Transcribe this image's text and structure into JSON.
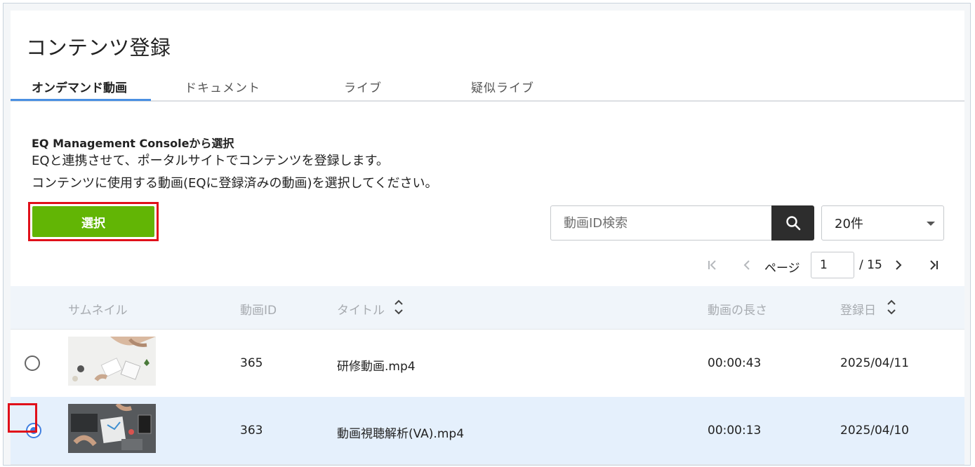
{
  "page": {
    "title": "コンテンツ登録"
  },
  "tabs": [
    {
      "label": "オンデマンド動画",
      "active": true
    },
    {
      "label": "ドキュメント",
      "active": false
    },
    {
      "label": "ライブ",
      "active": false
    },
    {
      "label": "疑似ライブ",
      "active": false
    }
  ],
  "section": {
    "heading": "EQ Management Consoleから選択",
    "line1": "EQと連携させて、ポータルサイトでコンテンツを登録します。",
    "line2": "コンテンツに使用する動画(EQに登録済みの動画)を選択してください。"
  },
  "select_button": {
    "label": "選択"
  },
  "search": {
    "placeholder": "動画ID検索",
    "value": "",
    "icon": "search-icon"
  },
  "per_page": {
    "selected": "20件"
  },
  "pagination": {
    "page_label": "ページ",
    "current_page": "1",
    "total_label": "/ 15"
  },
  "table": {
    "headers": {
      "thumbnail": "サムネイル",
      "video_id": "動画ID",
      "title": "タイトル",
      "length": "動画の長さ",
      "registered": "登録日"
    },
    "rows": [
      {
        "selected": false,
        "id": "365",
        "title": "研修動画.mp4",
        "length": "00:00:43",
        "date": "2025/04/11"
      },
      {
        "selected": true,
        "id": "363",
        "title": "動画視聴解析(VA).mp4",
        "length": "00:00:13",
        "date": "2025/04/10"
      }
    ]
  },
  "colors": {
    "primary_green": "#62b505",
    "tab_active_underline": "#4a90e2",
    "highlight_red": "#e0101a",
    "selected_row": "#e5f0fc",
    "radio_on": "#3f7fe0"
  }
}
